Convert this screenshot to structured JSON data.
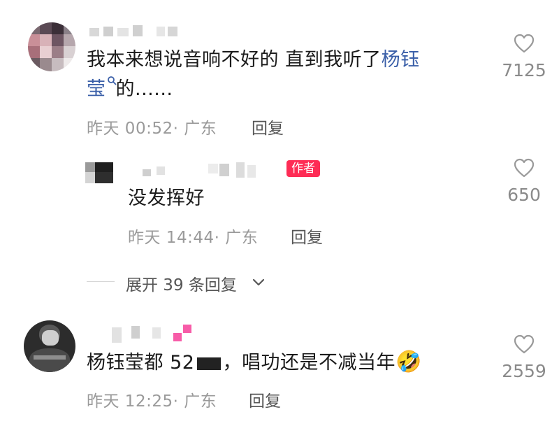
{
  "comments": [
    {
      "text_line1_a": "我本来想说音响不好的 直到我听了",
      "text_line1_link": "杨钰",
      "text_line2_link": "莹",
      "text_line2_b": "的......",
      "timestamp": "昨天 00:52",
      "location": "· 广东",
      "reply_label": "回复",
      "like_count": "7125"
    },
    {
      "is_author": true,
      "author_badge": "作者",
      "text": "没发挥好",
      "timestamp": "昨天 14:44",
      "location": "· 广东",
      "reply_label": "回复",
      "like_count": "650"
    },
    {
      "text_a": "杨钰莹都 52",
      "text_b": "，唱功还是不减当年",
      "emoji": "🤣",
      "timestamp": "昨天 12:25",
      "location": "· 广东",
      "reply_label": "回复",
      "like_count": "2559"
    }
  ],
  "expand_replies": {
    "label": "展开 39 条回复",
    "icon": "chevron-down-icon"
  },
  "icons": {
    "like": "heart-outline-icon",
    "search": "search-icon"
  },
  "colors": {
    "author_badge": "#fe2c55",
    "link": "#3a5fa8",
    "meta": "#9a9a9a"
  }
}
